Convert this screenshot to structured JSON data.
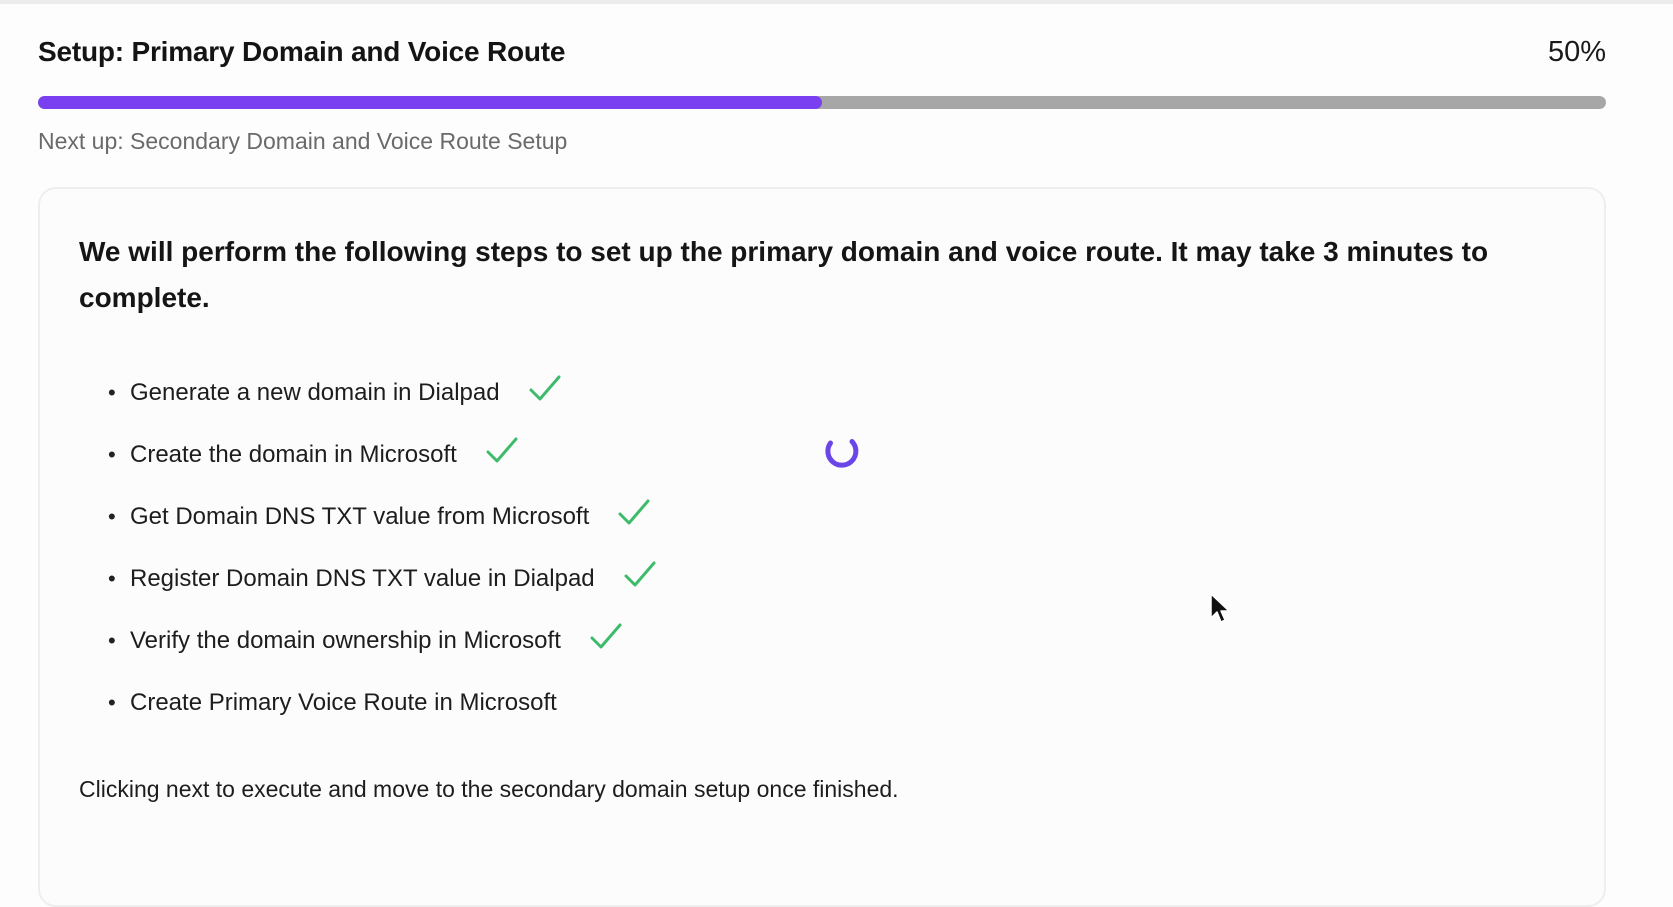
{
  "header": {
    "title": "Setup: Primary Domain and Voice Route",
    "percent_label": "50%",
    "progress_fraction": 0.5
  },
  "next_up": "Next up: Secondary Domain and Voice Route Setup",
  "card": {
    "intro": "We will perform the following steps to set up the primary domain and voice route. It may take 3 minutes to complete.",
    "steps": [
      {
        "label": "Generate a new domain in Dialpad",
        "done": true
      },
      {
        "label": "Create the domain in Microsoft",
        "done": true
      },
      {
        "label": "Get Domain DNS TXT value from Microsoft",
        "done": true
      },
      {
        "label": "Register Domain DNS TXT value in Dialpad",
        "done": true
      },
      {
        "label": "Verify the domain ownership in Microsoft",
        "done": true
      },
      {
        "label": "Create Primary Voice Route in Microsoft",
        "done": false
      }
    ],
    "footer": "Clicking next to execute and move to the secondary domain setup once finished."
  },
  "colors": {
    "accent": "#7a3ff0",
    "track": "#a7a7a7",
    "check": "#3dbb6a",
    "spinner": "#6a45e8"
  },
  "icons": {
    "check": "checkmark-icon",
    "spinner": "loading-spinner-icon",
    "cursor": "mouse-pointer-icon"
  }
}
